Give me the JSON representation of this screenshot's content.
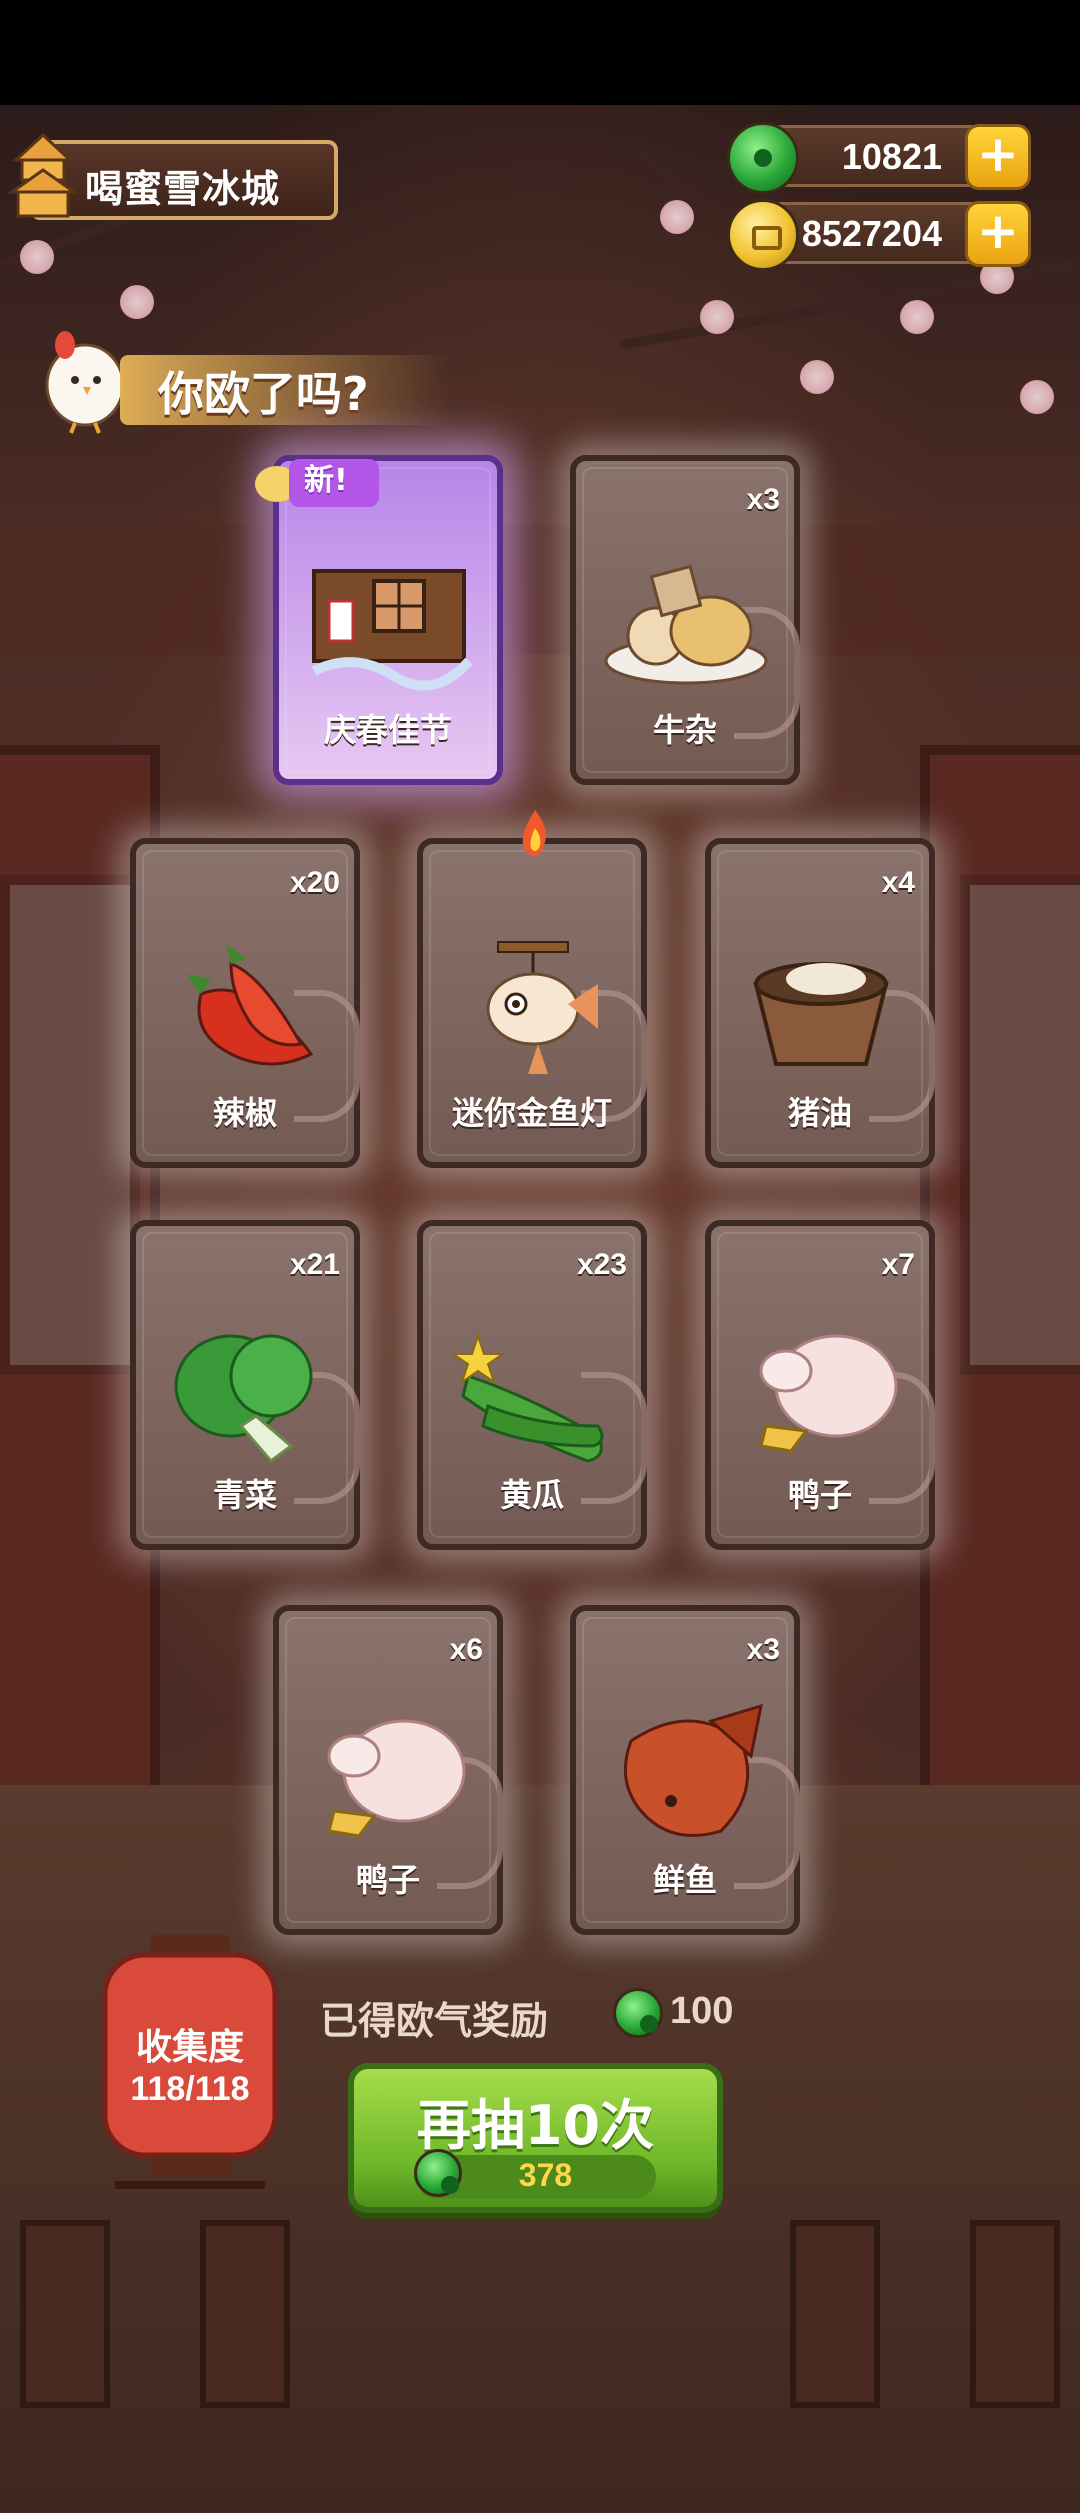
{
  "top": {
    "city_name": "喝蜜雪冰城",
    "jade_amount": "10821",
    "coin_amount": "8527204",
    "plus_label": "+"
  },
  "banner": {
    "text": "你欧了吗?"
  },
  "new_tag": "新!",
  "cards": [
    {
      "name": "庆春佳节",
      "count": "",
      "icon": "festival-window-icon",
      "rarity": "purple",
      "is_new": true
    },
    {
      "name": "牛杂",
      "count": "x3",
      "icon": "beef-offal-icon"
    },
    {
      "name": "辣椒",
      "count": "x20",
      "icon": "chili-pepper-icon"
    },
    {
      "name": "迷你金鱼灯",
      "count": "",
      "icon": "goldfish-lantern-icon"
    },
    {
      "name": "猪油",
      "count": "x4",
      "icon": "lard-bowl-icon"
    },
    {
      "name": "青菜",
      "count": "x21",
      "icon": "bok-choy-icon"
    },
    {
      "name": "黄瓜",
      "count": "x23",
      "icon": "cucumber-icon"
    },
    {
      "name": "鸭子",
      "count": "x7",
      "icon": "duck-icon"
    },
    {
      "name": "鸭子",
      "count": "x6",
      "icon": "duck-icon"
    },
    {
      "name": "鲜鱼",
      "count": "x3",
      "icon": "fish-icon"
    }
  ],
  "collection": {
    "title": "收集度",
    "progress": "118/118"
  },
  "reward": {
    "label": "已得欧气奖励",
    "value": "100"
  },
  "draw_button": {
    "label": "再抽10次",
    "cost": "378"
  },
  "colors": {
    "button_green": "#6eb629",
    "jade_green": "#29a838",
    "coin_gold": "#f2c232",
    "purple_card": "#b785e8"
  }
}
